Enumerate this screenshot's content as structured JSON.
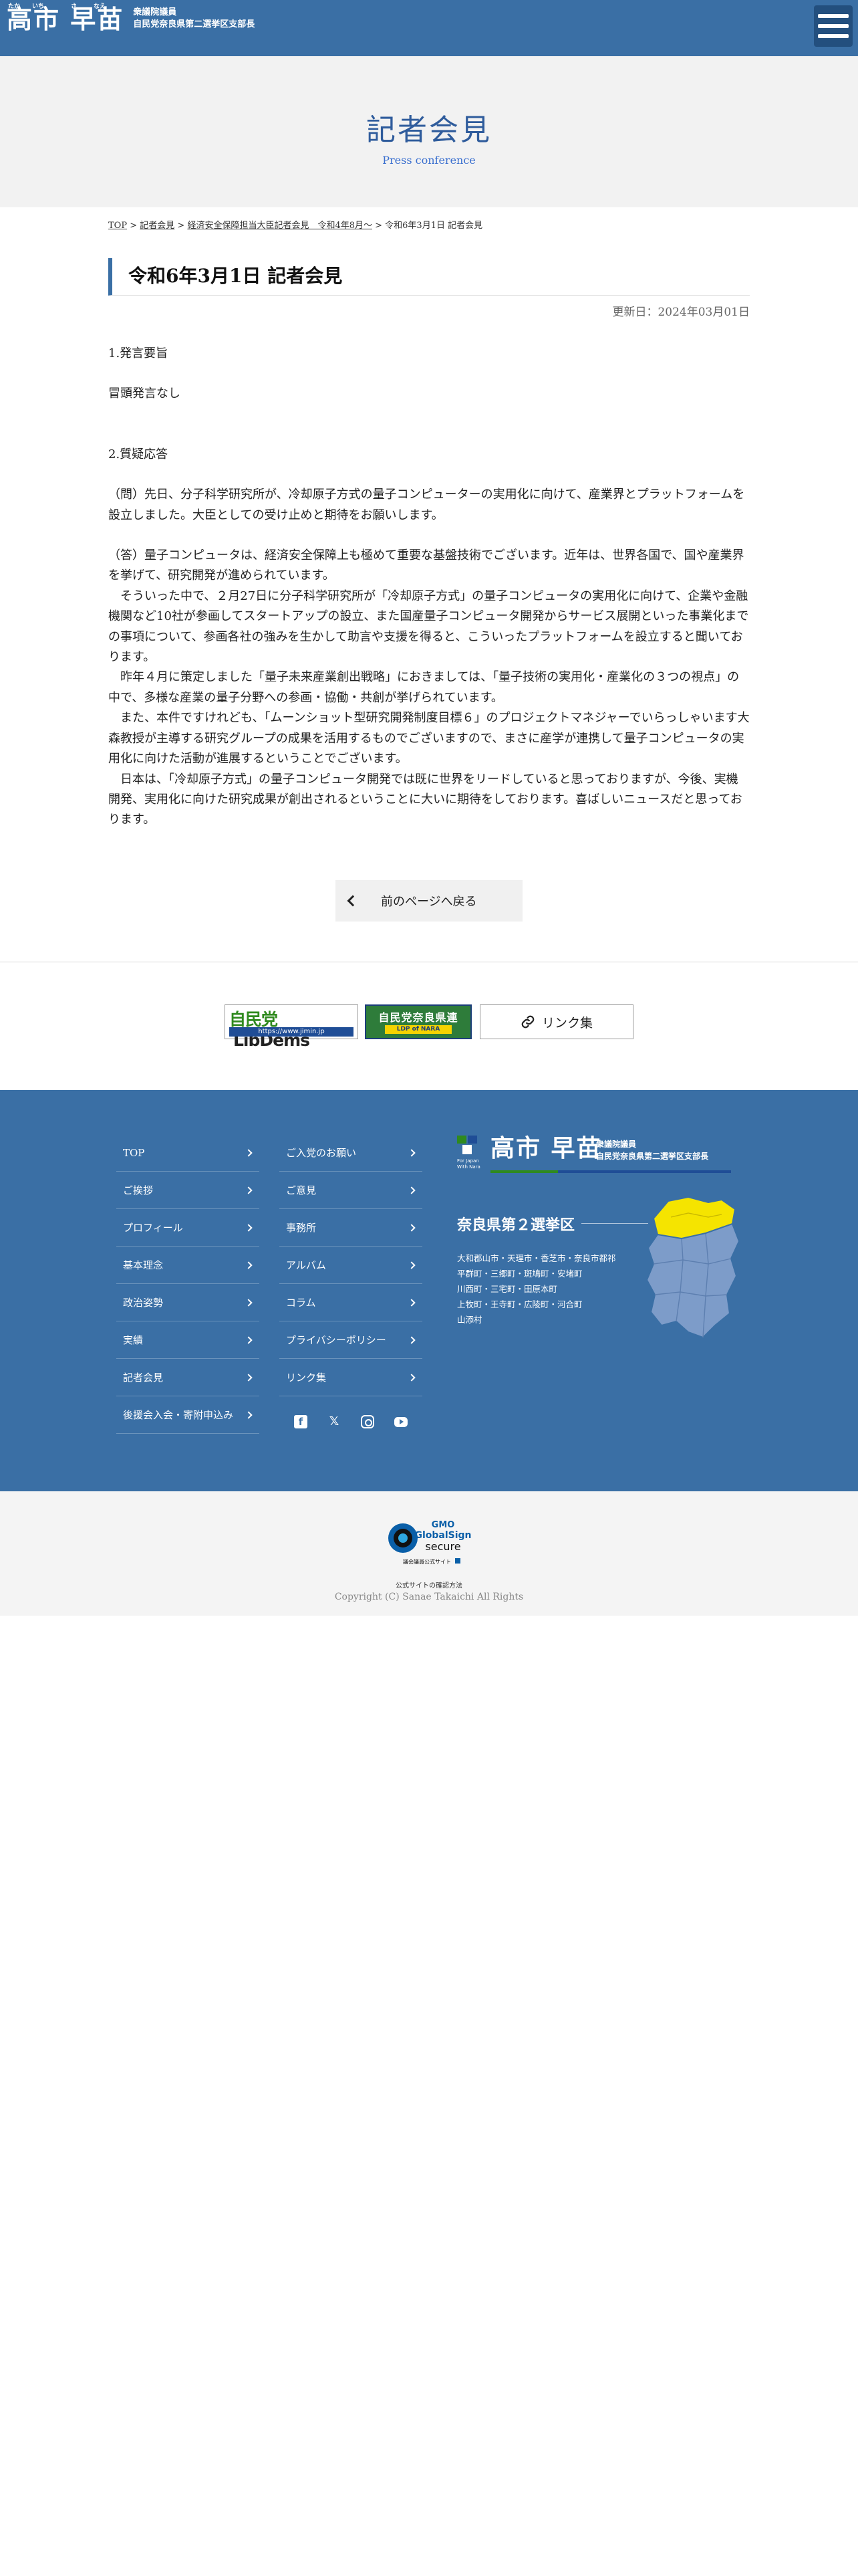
{
  "header": {
    "name": "高市 早苗",
    "ruby": [
      "たか",
      "いち",
      "さ",
      "なえ"
    ],
    "sub1": "衆議院議員",
    "sub2": "自民党奈良県第二選挙区支部長"
  },
  "hero": {
    "title": "記者会見",
    "subtitle": "Press conference"
  },
  "breadcrumb": {
    "items": [
      "TOP",
      "記者会見",
      "経済安全保障担当大臣記者会見　令和4年8月〜"
    ],
    "sep": " > ",
    "current": "令和6年3月1日 記者会見"
  },
  "article": {
    "title": "令和6年3月1日 記者会見",
    "updated": "更新日：2024年03月01日",
    "h1": "1.発言要旨",
    "p1": "冒頭発言なし",
    "h2": "2.質疑応答",
    "q": "（問）先日、分子科学研究所が、冷却原子方式の量子コンピューターの実用化に向けて、産業界とプラットフォームを設立しました。大臣としての受け止めと期待をお願いします。",
    "a1": "（答）量子コンピュータは、経済安全保障上も極めて重要な基盤技術でございます。近年は、世界各国で、国や産業界を挙げて、研究開発が進められています。",
    "a2": "　そういった中で、２月27日に分子科学研究所が「冷却原子方式」の量子コンピュータの実用化に向けて、企業や金融機関など10社が参画してスタートアップの設立、また国産量子コンピュータ開発からサービス展開といった事業化までの事項について、参画各社の強みを生かして助言や支援を得ると、こういったプラットフォームを設立すると聞いております。",
    "a3": "　昨年４月に策定しました「量子未来産業創出戦略」におきましては、「量子技術の実用化・産業化の３つの視点」の中で、多様な産業の量子分野への参画・協働・共創が挙げられています。",
    "a4": "　また、本件ですけれども、「ムーンショット型研究開発制度目標６」のプロジェクトマネジャーでいらっしゃいます大森教授が主導する研究グループの成果を活用するものでございますので、まさに産学が連携して量子コンピュータの実用化に向けた活動が進展するということでございます。",
    "a5": "　日本は、「冷却原子方式」の量子コンピュータ開発では既に世界をリードしていると思っておりますが、今後、実機開発、実用化に向けた研究成果が創出されるということに大いに期待をしております。喜ばしいニュースだと思っております。",
    "back": "前のページへ戻る"
  },
  "banners": {
    "libdems": "自民党",
    "libdems_en": "LibDems",
    "libdems_url": "https://www.jimin.jp",
    "nara": "自民党奈良県連",
    "nara_sub": "LDP of NARA",
    "links": "リンク集"
  },
  "footer": {
    "col1": [
      "TOP",
      "ご挨拶",
      "プロフィール",
      "基本理念",
      "政治姿勢",
      "実績",
      "記者会見",
      "後援会入会・寄附申込み"
    ],
    "col2": [
      "ご入党のお願い",
      "ご意見",
      "事務所",
      "アルバム",
      "コラム",
      "プライバシーポリシー",
      "リンク集"
    ],
    "logo_name": "高市 早苗",
    "logo_sub1": "衆議院議員",
    "logo_sub2": "自民党奈良県第二選挙区支部長",
    "mark_text1": "For Japan",
    "mark_text2": "With Nara",
    "district_title": "奈良県第２選挙区",
    "district_lines": [
      "大和郡山市・天理市・香芝市・奈良市都祁",
      "平群町・三郷町・斑鳩町・安堵町",
      "川西町・三宅町・田原本町",
      "上牧町・王寺町・広陵町・河合町",
      "山添村"
    ],
    "social_icons": [
      "facebook-icon",
      "x-icon",
      "instagram-icon",
      "youtube-icon"
    ],
    "highlight_color": "#f5e400"
  },
  "bottom": {
    "seal_line1": "GMO",
    "seal_line2": "GlobalSign",
    "seal_line3": "secure",
    "seal_line4": "議会議員公式サイト",
    "seal_caption": "公式サイトの確認方法",
    "copyright": "Copyright (C) Sanae Takaichi All Rights"
  }
}
